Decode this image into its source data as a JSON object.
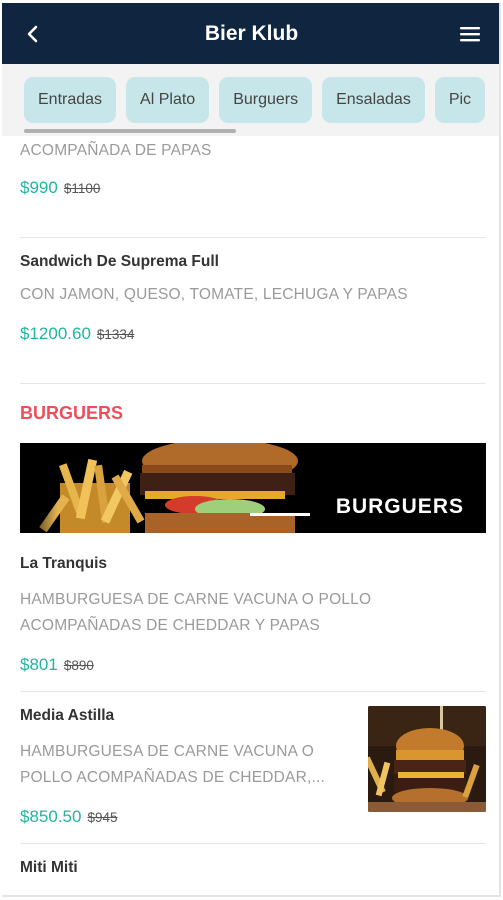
{
  "header": {
    "title": "Bier Klub",
    "back_icon": "chevron-left-icon",
    "menu_icon": "hamburger-menu-icon",
    "background": "#0f2540"
  },
  "tabs": [
    {
      "label": "Entradas"
    },
    {
      "label": "Al Plato"
    },
    {
      "label": "Burguers"
    },
    {
      "label": "Ensaladas"
    },
    {
      "label": "Pic"
    }
  ],
  "items_top": [
    {
      "description": "ACOMPAÑADA DE PAPAS",
      "price": "$990",
      "old_price": "$1100"
    },
    {
      "name": "Sandwich De Suprema Full",
      "description": "CON JAMON, QUESO, TOMATE, LECHUGA Y PAPAS",
      "price": "$1200.60",
      "old_price": "$1334"
    }
  ],
  "section": {
    "title": "BURGUERS",
    "banner_text": "BURGUERS"
  },
  "burguer_items": [
    {
      "name": "La Tranquis",
      "description_line1": "HAMBURGUESA DE CARNE VACUNA O POLLO",
      "description_line2": "ACOMPAÑADAS DE CHEDDAR Y PAPAS",
      "price": "$801",
      "old_price": "$890"
    },
    {
      "name": "Media Astilla",
      "description_line1": "HAMBURGUESA DE CARNE VACUNA O",
      "description_line2": "POLLO ACOMPAÑADAS DE CHEDDAR,...",
      "price": "$850.50",
      "old_price": "$945"
    },
    {
      "name": "Miti Miti"
    }
  ],
  "colors": {
    "accent_price": "#20b5a0",
    "section_title": "#ef4d5a",
    "tab_bg": "#c7e6e9"
  }
}
